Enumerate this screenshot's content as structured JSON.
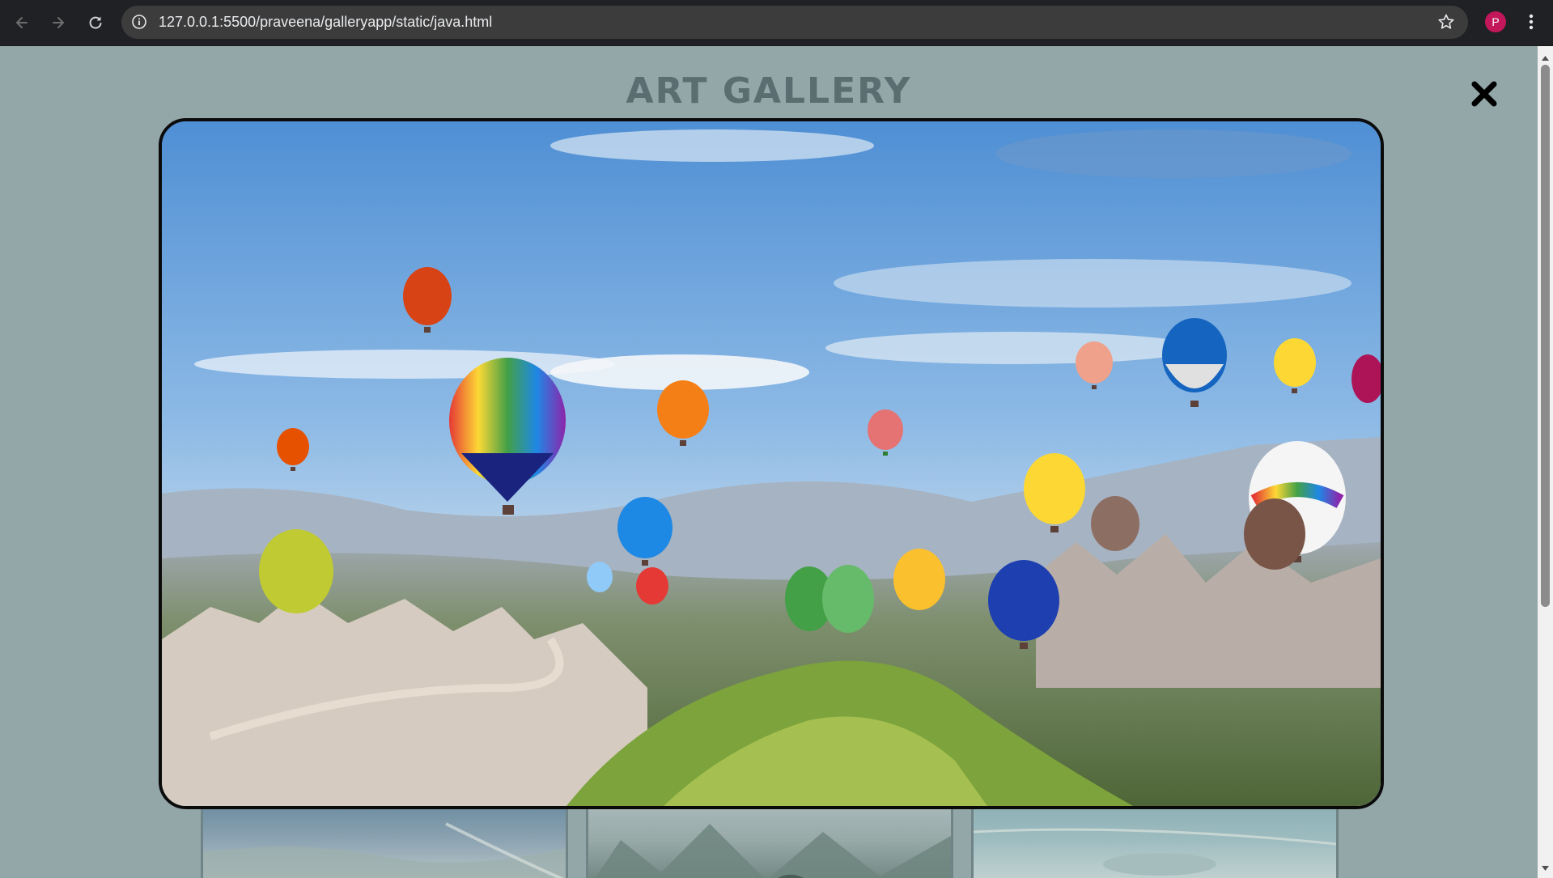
{
  "browser": {
    "url": "127.0.0.1:5500/praveena/galleryapp/static/java.html",
    "profile_initial": "P",
    "back_icon": "arrow-left-icon",
    "forward_icon": "arrow-right-icon",
    "reload_icon": "reload-icon",
    "site_info_icon": "info-icon",
    "bookmark_icon": "star-icon",
    "menu_icon": "kebab-menu-icon"
  },
  "page": {
    "title": "ART GALLERY",
    "close_icon": "close-icon",
    "modal_image": "hot-air-balloons-over-cappadocia-landscape",
    "thumbnails": [
      "coastline-thumbnail",
      "misty-forest-thumbnail",
      "lagoon-thumbnail"
    ]
  },
  "colors": {
    "overlay": "#93a6a8",
    "title": "#5a6e72",
    "modal_border": "#0b0b0b",
    "chrome": "#202124",
    "omnibox": "#3c3c3c",
    "avatar": "#c2185b"
  }
}
